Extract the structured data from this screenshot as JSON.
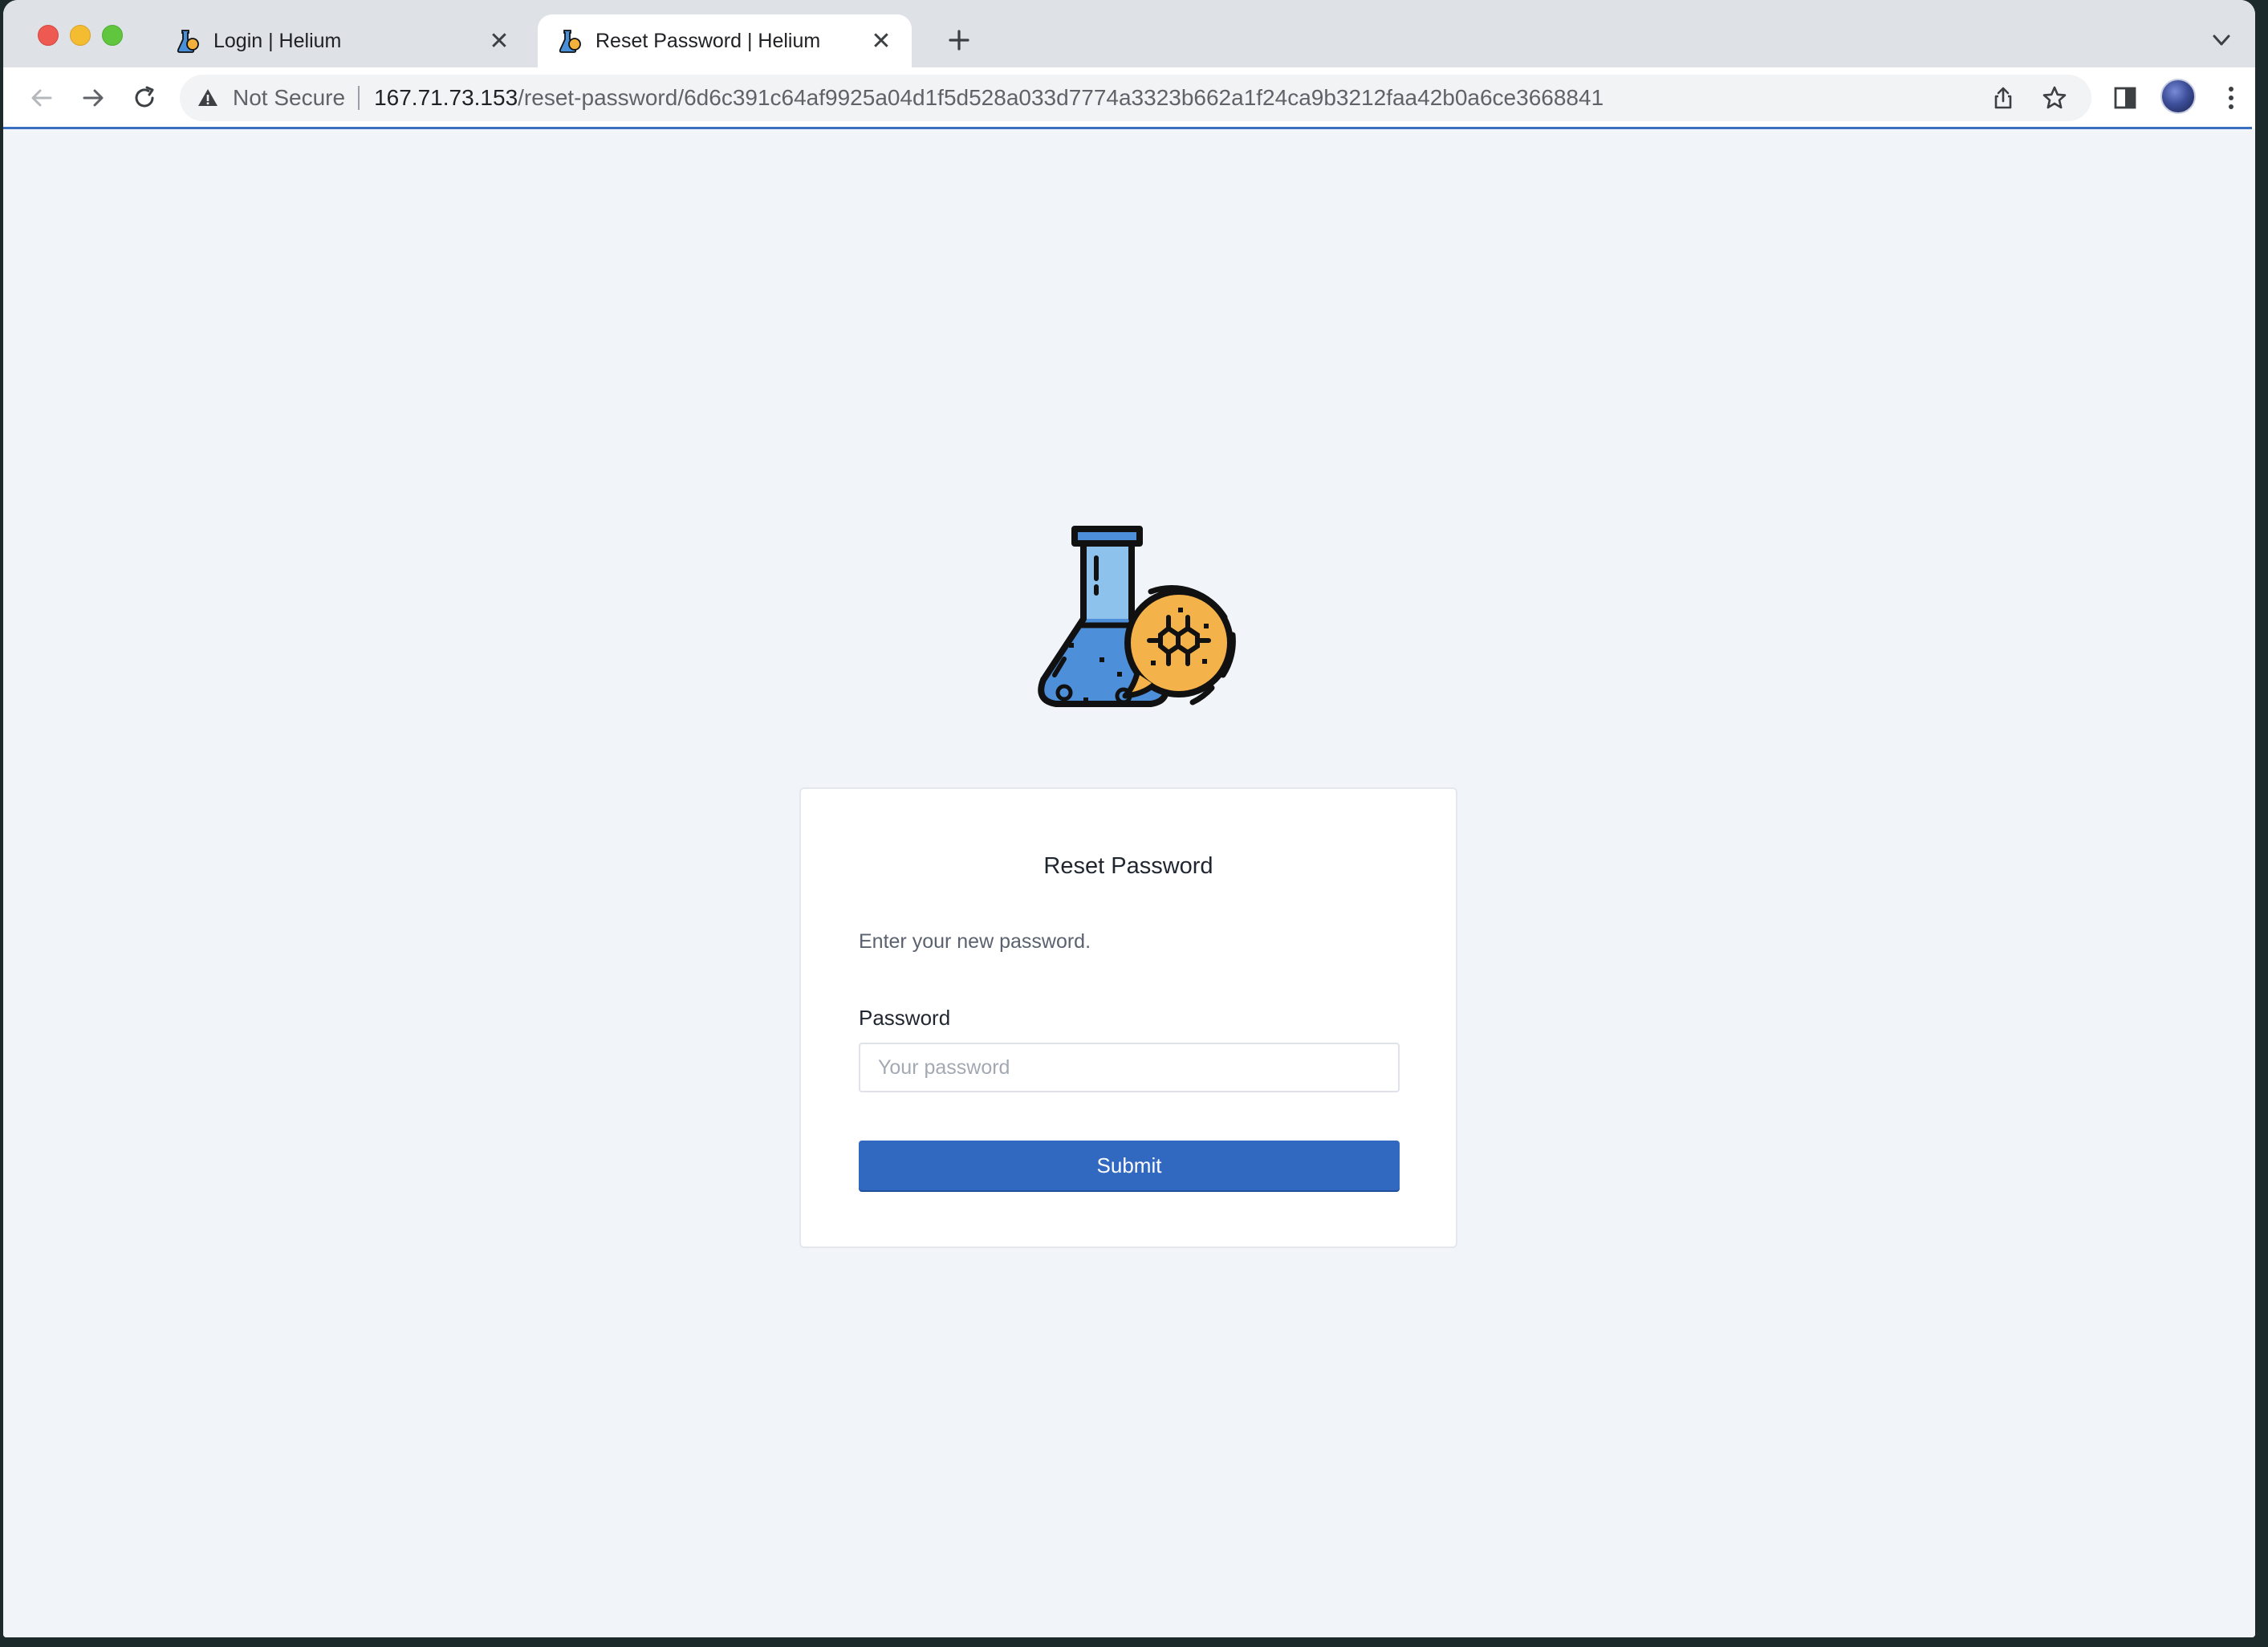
{
  "browser": {
    "tabs": [
      {
        "title": "Login | Helium",
        "active": false
      },
      {
        "title": "Reset Password | Helium",
        "active": true
      }
    ],
    "close_glyph": "✕",
    "new_tab_icon": "plus-icon",
    "address_bar": {
      "security_label": "Not Secure",
      "url_host": "167.71.73.153",
      "url_path": "/reset-password/6d6c391c64af9925a04d1f5d528a033d7774a3323b662a1f24ca9b3212faa42b0a6ce3668841"
    },
    "colors": {
      "tab_strip": "#dee1e6",
      "toolbar": "#ffffff",
      "progress": "#3a6fbf"
    }
  },
  "page": {
    "logo_icon": "flask-molecule-icon",
    "form": {
      "title": "Reset Password",
      "hint": "Enter your new password.",
      "password_label": "Password",
      "password_placeholder": "Your password",
      "password_value": "",
      "submit_label": "Submit"
    },
    "colors": {
      "background": "#f1f4f9",
      "card": "#ffffff",
      "primary_button": "#3168c0"
    }
  }
}
